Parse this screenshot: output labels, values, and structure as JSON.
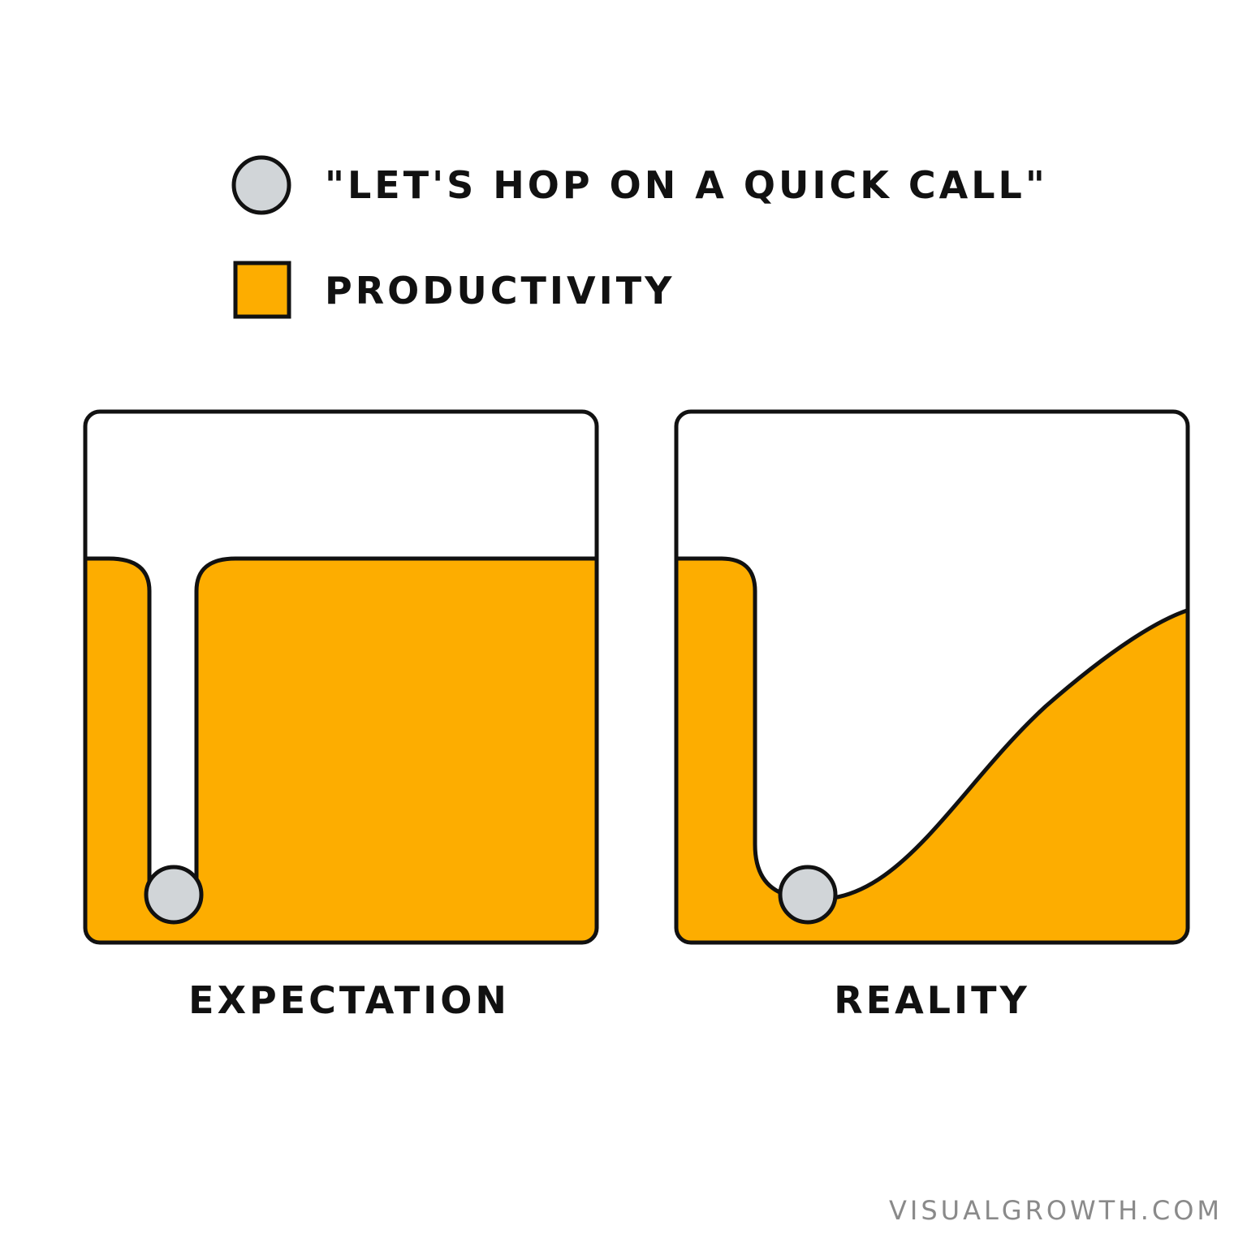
{
  "legend": {
    "items": [
      {
        "icon": "gray-circle",
        "label": "\"LET'S HOP ON A QUICK CALL\""
      },
      {
        "icon": "orange-square",
        "label": "PRODUCTIVITY"
      }
    ]
  },
  "panels": [
    {
      "caption": "EXPECTATION"
    },
    {
      "caption": "REALITY"
    }
  ],
  "footer": {
    "credit": "VISUALGROWTH.COM"
  },
  "colors": {
    "productivity_fill": "#FDAD00",
    "call_marker_fill": "#D1D5D8",
    "outline": "#111111",
    "footer_text": "#8A8A8A"
  }
}
